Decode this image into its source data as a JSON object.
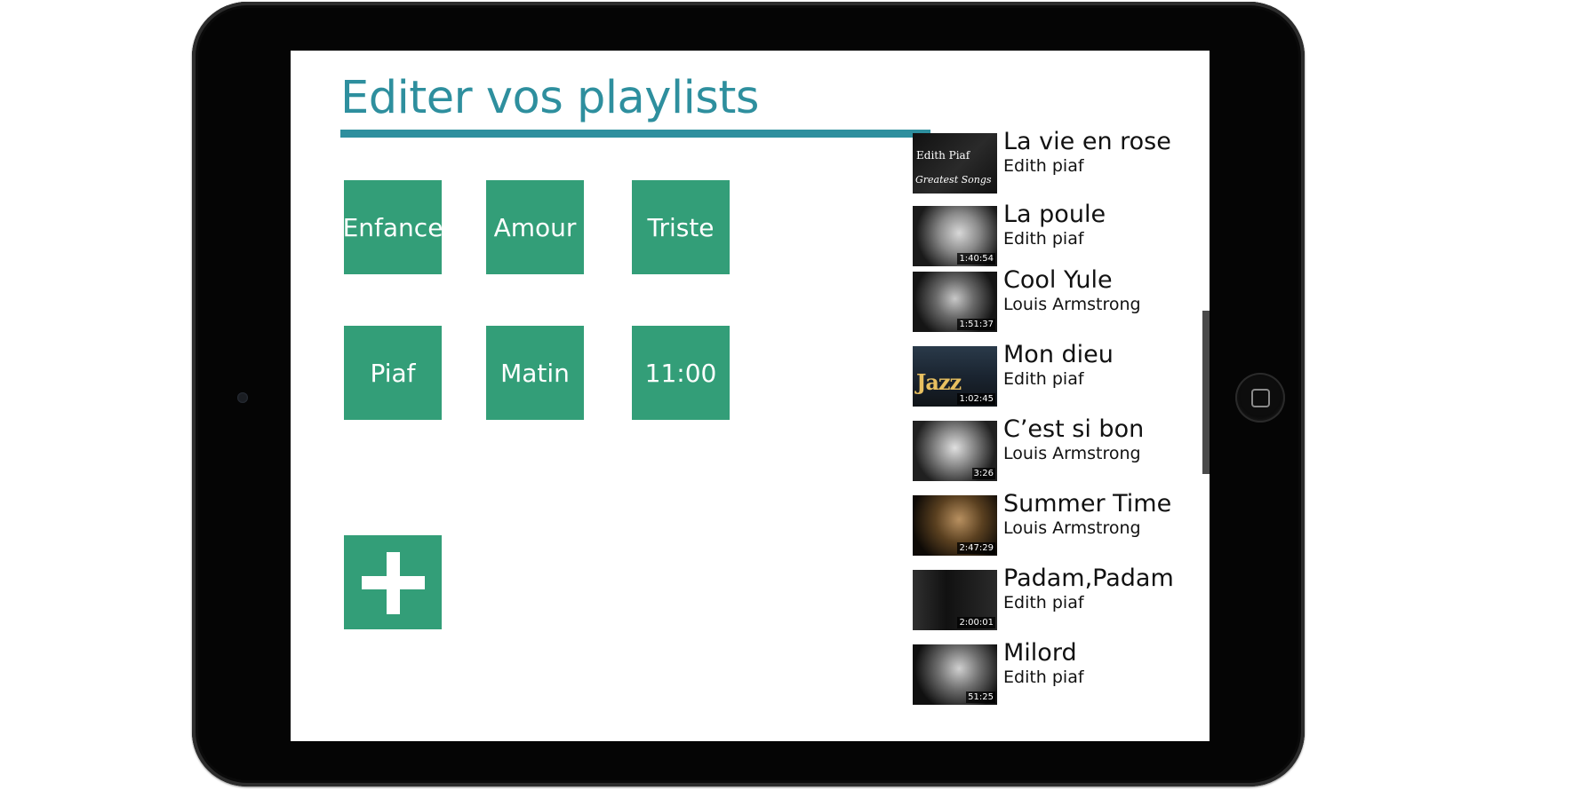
{
  "page": {
    "title": "Editer vos playlists"
  },
  "playlists": [
    {
      "label": "Enfance"
    },
    {
      "label": "Amour"
    },
    {
      "label": "Triste"
    },
    {
      "label": "Piaf"
    },
    {
      "label": "Matin"
    },
    {
      "label": "11:00"
    }
  ],
  "add_playlist": {
    "icon": "plus-icon"
  },
  "songs": [
    {
      "title": "La vie en rose",
      "artist": "Edith piaf",
      "thumb_text": "Edith Piaf",
      "thumb_caption": "Greatest Songs",
      "duration": ""
    },
    {
      "title": "La poule",
      "artist": "Edith piaf",
      "duration": "1:40:54"
    },
    {
      "title": "Cool Yule",
      "artist": "Louis Armstrong",
      "duration": "1:51:37"
    },
    {
      "title": "Mon dieu",
      "artist": "Edith piaf",
      "thumb_text": "Jazz",
      "duration": "1:02:45"
    },
    {
      "title": "C’est si bon",
      "artist": "Louis Armstrong",
      "duration": "3:26"
    },
    {
      "title": "Summer Time",
      "artist": "Louis Armstrong",
      "duration": "2:47:29"
    },
    {
      "title": "Padam,Padam",
      "artist": "Edith piaf",
      "duration": "2:00:01"
    },
    {
      "title": "Milord",
      "artist": "Edith piaf",
      "duration": "51:25"
    }
  ],
  "colors": {
    "title_accent": "#2e8f9e",
    "tile_green": "#339e78",
    "device_bezel": "#050505"
  }
}
